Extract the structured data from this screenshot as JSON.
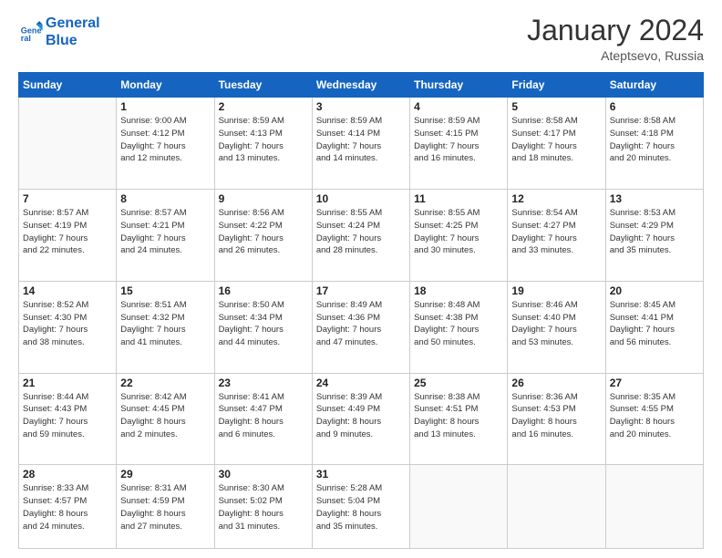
{
  "header": {
    "logo_line1": "General",
    "logo_line2": "Blue",
    "month": "January 2024",
    "location": "Ateptsevo, Russia"
  },
  "weekdays": [
    "Sunday",
    "Monday",
    "Tuesday",
    "Wednesday",
    "Thursday",
    "Friday",
    "Saturday"
  ],
  "rows": [
    [
      {
        "day": "",
        "info": ""
      },
      {
        "day": "1",
        "info": "Sunrise: 9:00 AM\nSunset: 4:12 PM\nDaylight: 7 hours\nand 12 minutes."
      },
      {
        "day": "2",
        "info": "Sunrise: 8:59 AM\nSunset: 4:13 PM\nDaylight: 7 hours\nand 13 minutes."
      },
      {
        "day": "3",
        "info": "Sunrise: 8:59 AM\nSunset: 4:14 PM\nDaylight: 7 hours\nand 14 minutes."
      },
      {
        "day": "4",
        "info": "Sunrise: 8:59 AM\nSunset: 4:15 PM\nDaylight: 7 hours\nand 16 minutes."
      },
      {
        "day": "5",
        "info": "Sunrise: 8:58 AM\nSunset: 4:17 PM\nDaylight: 7 hours\nand 18 minutes."
      },
      {
        "day": "6",
        "info": "Sunrise: 8:58 AM\nSunset: 4:18 PM\nDaylight: 7 hours\nand 20 minutes."
      }
    ],
    [
      {
        "day": "7",
        "info": "Sunrise: 8:57 AM\nSunset: 4:19 PM\nDaylight: 7 hours\nand 22 minutes."
      },
      {
        "day": "8",
        "info": "Sunrise: 8:57 AM\nSunset: 4:21 PM\nDaylight: 7 hours\nand 24 minutes."
      },
      {
        "day": "9",
        "info": "Sunrise: 8:56 AM\nSunset: 4:22 PM\nDaylight: 7 hours\nand 26 minutes."
      },
      {
        "day": "10",
        "info": "Sunrise: 8:55 AM\nSunset: 4:24 PM\nDaylight: 7 hours\nand 28 minutes."
      },
      {
        "day": "11",
        "info": "Sunrise: 8:55 AM\nSunset: 4:25 PM\nDaylight: 7 hours\nand 30 minutes."
      },
      {
        "day": "12",
        "info": "Sunrise: 8:54 AM\nSunset: 4:27 PM\nDaylight: 7 hours\nand 33 minutes."
      },
      {
        "day": "13",
        "info": "Sunrise: 8:53 AM\nSunset: 4:29 PM\nDaylight: 7 hours\nand 35 minutes."
      }
    ],
    [
      {
        "day": "14",
        "info": "Sunrise: 8:52 AM\nSunset: 4:30 PM\nDaylight: 7 hours\nand 38 minutes."
      },
      {
        "day": "15",
        "info": "Sunrise: 8:51 AM\nSunset: 4:32 PM\nDaylight: 7 hours\nand 41 minutes."
      },
      {
        "day": "16",
        "info": "Sunrise: 8:50 AM\nSunset: 4:34 PM\nDaylight: 7 hours\nand 44 minutes."
      },
      {
        "day": "17",
        "info": "Sunrise: 8:49 AM\nSunset: 4:36 PM\nDaylight: 7 hours\nand 47 minutes."
      },
      {
        "day": "18",
        "info": "Sunrise: 8:48 AM\nSunset: 4:38 PM\nDaylight: 7 hours\nand 50 minutes."
      },
      {
        "day": "19",
        "info": "Sunrise: 8:46 AM\nSunset: 4:40 PM\nDaylight: 7 hours\nand 53 minutes."
      },
      {
        "day": "20",
        "info": "Sunrise: 8:45 AM\nSunset: 4:41 PM\nDaylight: 7 hours\nand 56 minutes."
      }
    ],
    [
      {
        "day": "21",
        "info": "Sunrise: 8:44 AM\nSunset: 4:43 PM\nDaylight: 7 hours\nand 59 minutes."
      },
      {
        "day": "22",
        "info": "Sunrise: 8:42 AM\nSunset: 4:45 PM\nDaylight: 8 hours\nand 2 minutes."
      },
      {
        "day": "23",
        "info": "Sunrise: 8:41 AM\nSunset: 4:47 PM\nDaylight: 8 hours\nand 6 minutes."
      },
      {
        "day": "24",
        "info": "Sunrise: 8:39 AM\nSunset: 4:49 PM\nDaylight: 8 hours\nand 9 minutes."
      },
      {
        "day": "25",
        "info": "Sunrise: 8:38 AM\nSunset: 4:51 PM\nDaylight: 8 hours\nand 13 minutes."
      },
      {
        "day": "26",
        "info": "Sunrise: 8:36 AM\nSunset: 4:53 PM\nDaylight: 8 hours\nand 16 minutes."
      },
      {
        "day": "27",
        "info": "Sunrise: 8:35 AM\nSunset: 4:55 PM\nDaylight: 8 hours\nand 20 minutes."
      }
    ],
    [
      {
        "day": "28",
        "info": "Sunrise: 8:33 AM\nSunset: 4:57 PM\nDaylight: 8 hours\nand 24 minutes."
      },
      {
        "day": "29",
        "info": "Sunrise: 8:31 AM\nSunset: 4:59 PM\nDaylight: 8 hours\nand 27 minutes."
      },
      {
        "day": "30",
        "info": "Sunrise: 8:30 AM\nSunset: 5:02 PM\nDaylight: 8 hours\nand 31 minutes."
      },
      {
        "day": "31",
        "info": "Sunrise: 5:28 AM\nSunset: 5:04 PM\nDaylight: 8 hours\nand 35 minutes."
      },
      {
        "day": "",
        "info": ""
      },
      {
        "day": "",
        "info": ""
      },
      {
        "day": "",
        "info": ""
      }
    ]
  ]
}
